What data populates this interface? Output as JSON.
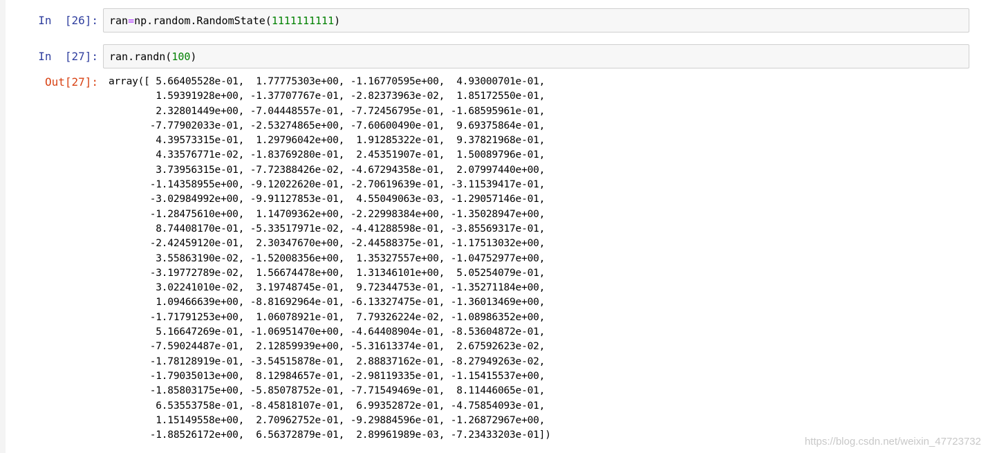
{
  "cells": [
    {
      "prompt": "In  [26]:",
      "code": {
        "a": "ran",
        "op": "=",
        "b": "np.random.RandomState(",
        "num": "1111111111",
        "c": ")"
      }
    },
    {
      "prompt": "In  [27]:",
      "code": {
        "a": "ran.randn(",
        "num": "100",
        "c": ")"
      },
      "output_prompt": "Out[27]:",
      "output": "array([ 5.66405528e-01,  1.77775303e+00, -1.16770595e+00,  4.93000701e-01,\n        1.59391928e+00, -1.37707767e-01, -2.82373963e-02,  1.85172550e-01,\n        2.32801449e+00, -7.04448557e-01, -7.72456795e-01, -1.68595961e-01,\n       -7.77902033e-01, -2.53274865e+00, -7.60600490e-01,  9.69375864e-01,\n        4.39573315e-01,  1.29796042e+00,  1.91285322e-01,  9.37821968e-01,\n        4.33576771e-02, -1.83769280e-01,  2.45351907e-01,  1.50089796e-01,\n        3.73956315e-01, -7.72388426e-02, -4.67294358e-01,  2.07997440e+00,\n       -1.14358955e+00, -9.12022620e-01, -2.70619639e-01, -3.11539417e-01,\n       -3.02984992e+00, -9.91127853e-01,  4.55049063e-03, -1.29057146e-01,\n       -1.28475610e+00,  1.14709362e+00, -2.22998384e+00, -1.35028947e+00,\n        8.74408170e-01, -5.33517971e-02, -4.41288598e-01, -3.85569317e-01,\n       -2.42459120e-01,  2.30347670e+00, -2.44588375e-01, -1.17513032e+00,\n        3.55863190e-02, -1.52008356e+00,  1.35327557e+00, -1.04752977e+00,\n       -3.19772789e-02,  1.56674478e+00,  1.31346101e+00,  5.05254079e-01,\n        3.02241010e-02,  3.19748745e-01,  9.72344753e-01, -1.35271184e+00,\n        1.09466639e+00, -8.81692964e-01, -6.13327475e-01, -1.36013469e+00,\n       -1.71791253e+00,  1.06078921e-01,  7.79326224e-02, -1.08986352e+00,\n        5.16647269e-01, -1.06951470e+00, -4.64408904e-01, -8.53604872e-01,\n       -7.59024487e-01,  2.12859939e+00, -5.31613374e-01,  2.67592623e-02,\n       -1.78128919e-01, -3.54515878e-01,  2.88837162e-01, -8.27949263e-02,\n       -1.79035013e+00,  8.12984657e-01, -2.98119335e-01, -1.15415537e+00,\n       -1.85803175e+00, -5.85078752e-01, -7.71549469e-01,  8.11446065e-01,\n        6.53553758e-01, -8.45818107e-01,  6.99352872e-01, -4.75854093e-01,\n        1.15149558e+00,  2.70962752e-01, -9.29884596e-01, -1.26872967e+00,\n       -1.88526172e+00,  6.56372879e-01,  2.89961989e-03, -7.23433203e-01])"
    }
  ],
  "watermark": "https://blog.csdn.net/weixin_47723732",
  "colors": {
    "in_prompt": "#303f9f",
    "out_prompt": "#d84315",
    "operator": "#aa22ff",
    "number": "#008000"
  }
}
